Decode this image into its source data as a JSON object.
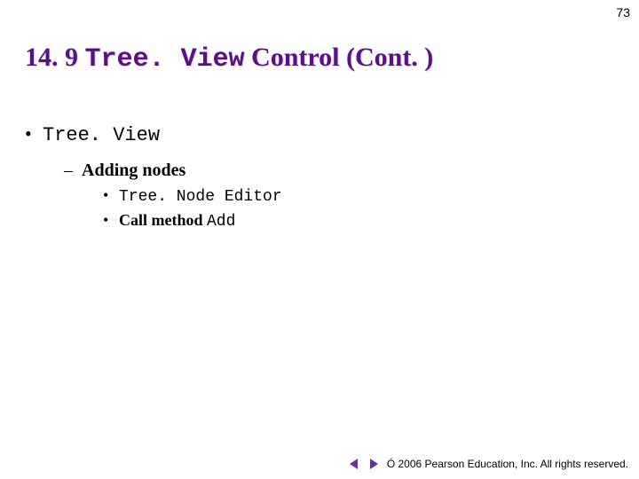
{
  "page_number": "73",
  "title": {
    "section": "14. 9 ",
    "code": "Tree. View",
    "rest": " Control (Cont. )"
  },
  "bullets": {
    "l1_dot": "•",
    "l1_code": "Tree. View",
    "l2_dash": "–",
    "l2_text": "Adding nodes",
    "l3a_dot": "•",
    "l3a_code": "Tree. Node Editor",
    "l3b_dot": "•",
    "l3b_prefix": "Call method ",
    "l3b_code": "Add"
  },
  "footer": {
    "copyright": "Ó 2006 Pearson Education, Inc.  All rights reserved."
  },
  "colors": {
    "heading": "#5b0f8b",
    "nav": "#6a2fa0"
  }
}
